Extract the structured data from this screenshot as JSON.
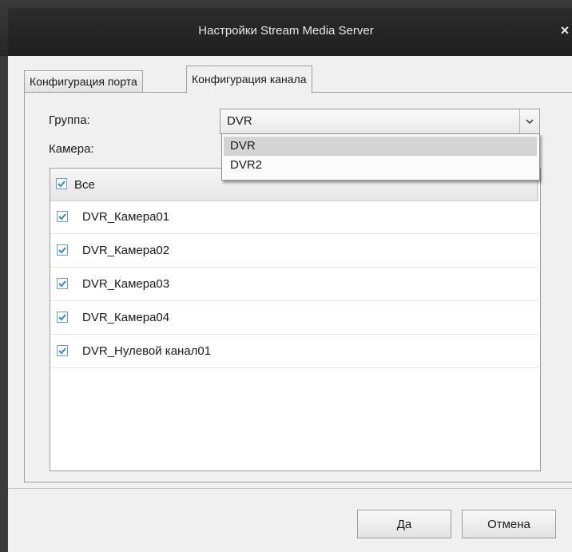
{
  "window": {
    "title": "Настройки Stream Media Server",
    "close_symbol": "×"
  },
  "tabs": [
    {
      "label": "Конфигурация порта",
      "active": false
    },
    {
      "label": "Конфигурация канала",
      "active": true
    }
  ],
  "form": {
    "group_label": "Группа:",
    "group_value": "DVR",
    "group_options": [
      "DVR",
      "DVR2"
    ],
    "camera_label": "Камера:"
  },
  "camera_list": {
    "header": {
      "label": "Все",
      "checked": true
    },
    "items": [
      {
        "label": "DVR_Камера01",
        "checked": true
      },
      {
        "label": "DVR_Камера02",
        "checked": true
      },
      {
        "label": "DVR_Камера03",
        "checked": true
      },
      {
        "label": "DVR_Камера04",
        "checked": true
      },
      {
        "label": "DVR_Нулевой канал01",
        "checked": true
      }
    ]
  },
  "buttons": {
    "ok": "Да",
    "cancel": "Отмена"
  },
  "colors": {
    "titlebar": "#262626",
    "checkmark": "#2a8bd6"
  }
}
